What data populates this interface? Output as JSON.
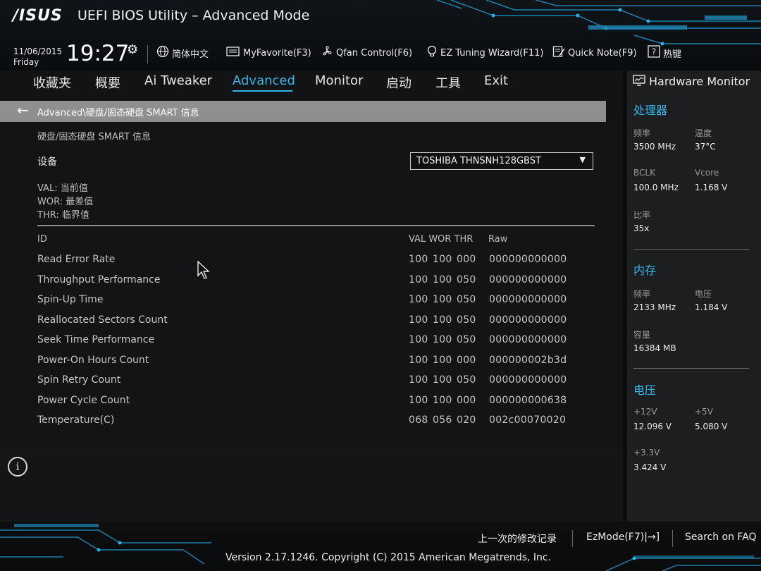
{
  "header": {
    "brand": "/ISUS",
    "title": "UEFI BIOS Utility – Advanced Mode",
    "date": "11/06/2015",
    "day": "Friday",
    "time": "19:27",
    "tools": [
      {
        "icon": "globe-icon",
        "label": "简体中文"
      },
      {
        "icon": "favorite-icon",
        "label": "MyFavorite(F3)"
      },
      {
        "icon": "fan-icon",
        "label": "Qfan Control(F6)"
      },
      {
        "icon": "bulb-icon",
        "label": "EZ Tuning Wizard(F11)"
      },
      {
        "icon": "note-icon",
        "label": "Quick Note(F9)"
      },
      {
        "icon": "help-icon",
        "label": "热键"
      }
    ]
  },
  "tabs": [
    {
      "label": "收藏夹"
    },
    {
      "label": "概要"
    },
    {
      "label": "Ai Tweaker"
    },
    {
      "label": "Advanced",
      "active": true
    },
    {
      "label": "Monitor"
    },
    {
      "label": "启动"
    },
    {
      "label": "工具"
    },
    {
      "label": "Exit"
    }
  ],
  "breadcrumb": "Advanced\\硬盘/固态硬盘 SMART 信息",
  "section_title": "硬盘/固态硬盘 SMART 信息",
  "device": {
    "label": "设备",
    "selected": "TOSHIBA THNSNH128GBST"
  },
  "legend": [
    "VAL: 当前值",
    "WOR: 最差值",
    "THR: 临界值"
  ],
  "table": {
    "headers": {
      "id": "ID",
      "vwt": "VAL WOR THR",
      "raw": "Raw"
    },
    "rows": [
      {
        "id": "Read Error Rate",
        "val": "100",
        "wor": "100",
        "thr": "000",
        "raw": "000000000000"
      },
      {
        "id": "Throughput Performance",
        "val": "100",
        "wor": "100",
        "thr": "050",
        "raw": "000000000000"
      },
      {
        "id": "Spin-Up Time",
        "val": "100",
        "wor": "100",
        "thr": "050",
        "raw": "000000000000"
      },
      {
        "id": "Reallocated Sectors Count",
        "val": "100",
        "wor": "100",
        "thr": "050",
        "raw": "000000000000"
      },
      {
        "id": "Seek Time Performance",
        "val": "100",
        "wor": "100",
        "thr": "050",
        "raw": "000000000000"
      },
      {
        "id": "Power-On Hours Count",
        "val": "100",
        "wor": "100",
        "thr": "000",
        "raw": "000000002b3d"
      },
      {
        "id": "Spin Retry Count",
        "val": "100",
        "wor": "100",
        "thr": "050",
        "raw": "000000000000"
      },
      {
        "id": "Power Cycle Count",
        "val": "100",
        "wor": "100",
        "thr": "000",
        "raw": "000000000638"
      },
      {
        "id": "Temperature(C)",
        "val": "068",
        "wor": "056",
        "thr": "020",
        "raw": "002c00070020"
      }
    ]
  },
  "hardware_monitor": {
    "title": "Hardware Monitor",
    "cpu": {
      "heading": "处理器",
      "freq_label": "频率",
      "freq": "3500 MHz",
      "temp_label": "温度",
      "temp": "37°C",
      "bclk_label": "BCLK",
      "bclk": "100.0 MHz",
      "vcore_label": "Vcore",
      "vcore": "1.168 V",
      "ratio_label": "比率",
      "ratio": "35x"
    },
    "memory": {
      "heading": "内存",
      "freq_label": "频率",
      "freq": "2133 MHz",
      "volt_label": "电压",
      "volt": "1.184 V",
      "cap_label": "容量",
      "cap": "16384 MB"
    },
    "voltage": {
      "heading": "电压",
      "v12_label": "+12V",
      "v12": "12.096 V",
      "v5_label": "+5V",
      "v5": "5.080 V",
      "v33_label": "+3.3V",
      "v33": "3.424 V"
    }
  },
  "footer": {
    "last_modified": "上一次的修改记录",
    "ezmode": "EzMode(F7)|→]",
    "search": "Search on FAQ",
    "version": "Version 2.17.1246. Copyright (C) 2015 American Megatrends, Inc."
  },
  "colors": {
    "accent": "#38b6e8",
    "breadcrumb_bg": "#8f8f8f",
    "panel_bg": "#121314",
    "monitor_bg": "#1c1e20"
  }
}
